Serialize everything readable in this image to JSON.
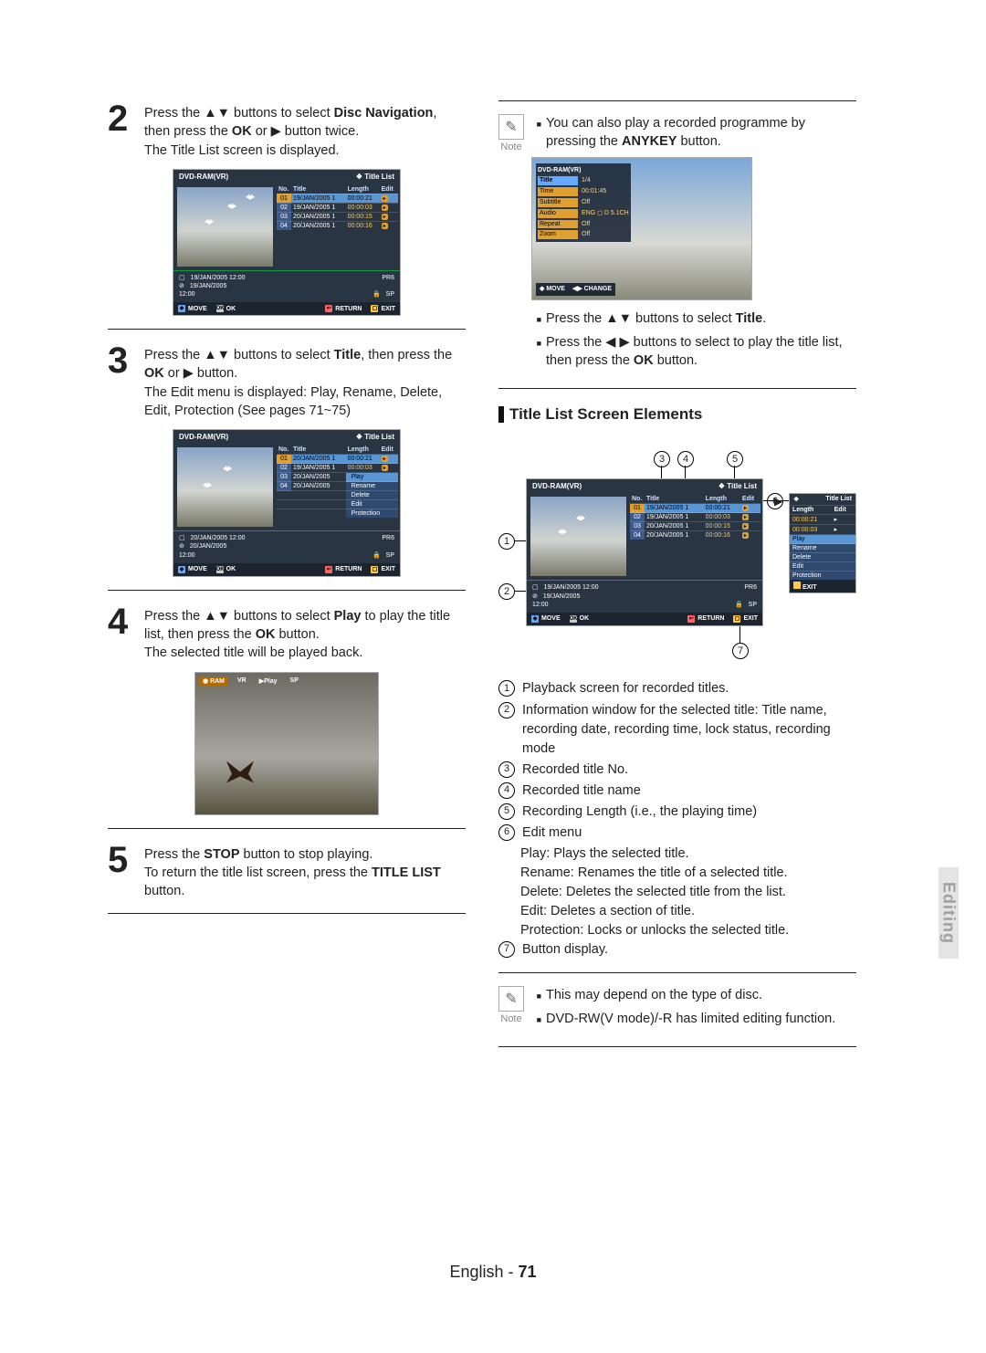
{
  "left": {
    "step2": {
      "num": "2",
      "pre": "Press the ",
      "arrows": "▲▼",
      "mid1": " buttons to select ",
      "bold1": "Disc Navigation",
      "mid2": ", then press the ",
      "bold2": "OK",
      "mid3": " or ",
      "play": "▶",
      "mid4": " button twice.",
      "line2": "The Title List screen is displayed."
    },
    "step3": {
      "num": "3",
      "pre": "Press the ",
      "arrows": "▲▼",
      "mid1": " buttons to select ",
      "bold1": "Title",
      "mid2": ", then press the ",
      "bold2": "OK",
      "mid3": " or ",
      "play": "▶",
      "mid4": " button.",
      "line2": "The Edit menu is displayed: Play, Rename, Delete, Edit, Protection (See pages 71~75)"
    },
    "step4": {
      "num": "4",
      "pre": "Press the ",
      "arrows": "▲▼",
      "mid1": " buttons to select ",
      "bold1": "Play",
      "mid2": " to play the title list, then press the ",
      "bold2": "OK",
      "mid3": " button.",
      "line2": "The selected title will be played back."
    },
    "step5": {
      "num": "5",
      "pre": "Press the ",
      "bold1": "STOP",
      "mid1": " button to stop playing.",
      "line2a": "To return the title list screen, press the ",
      "bold2": "TITLE LIST",
      "line2b": " button."
    },
    "osd1": {
      "device": "DVD-RAM(VR)",
      "title": "Title List",
      "cols": [
        "No.",
        "Title",
        "Length",
        "Edit"
      ],
      "rows": [
        {
          "no": "01",
          "title": "19/JAN/2005 1",
          "len": "00:00:21",
          "hl": true
        },
        {
          "no": "02",
          "title": "19/JAN/2005 1",
          "len": "00:00:03"
        },
        {
          "no": "03",
          "title": "20/JAN/2005 1",
          "len": "00:00:15"
        },
        {
          "no": "04",
          "title": "20/JAN/2005 1",
          "len": "00:00:16"
        }
      ],
      "info": {
        "a": "19/JAN/2005 12:00",
        "b": "PR6",
        "c": "19/JAN/2005",
        "d": "12:00",
        "e": "SP"
      },
      "bar": {
        "move": "MOVE",
        "ok": "OK",
        "ret": "RETURN",
        "exit": "EXIT"
      }
    },
    "osd2": {
      "device": "DVD-RAM(VR)",
      "title": "Title List",
      "cols": [
        "No.",
        "Title",
        "Length",
        "Edit"
      ],
      "rows": [
        {
          "no": "01",
          "title": "20/JAN/2005 1",
          "len": "00:00:21",
          "hl": true
        },
        {
          "no": "02",
          "title": "19/JAN/2005 1",
          "len": "00:00:03"
        },
        {
          "no": "03",
          "title": "20/JAN/2005",
          "sub": "Play"
        },
        {
          "no": "04",
          "title": "20/JAN/2005",
          "sub": "Rename"
        }
      ],
      "submenu": [
        "Delete",
        "Edit",
        "Protection"
      ],
      "info": {
        "a": "20/JAN/2005 12:00",
        "b": "PR6",
        "c": "20/JAN/2005",
        "d": "12:00",
        "e": "SP"
      },
      "bar": {
        "move": "MOVE",
        "ok": "OK",
        "ret": "RETURN",
        "exit": "EXIT"
      }
    },
    "play": {
      "ram": "RAM",
      "vr": "VR",
      "play": "▶Play",
      "sp": "SP"
    }
  },
  "right": {
    "note1": {
      "label": "Note",
      "li1a": "You can also play a recorded programme by pressing the ",
      "li1b": "ANYKEY",
      "li1c": " button.",
      "li2a": "Press the ",
      "li2arrows": "▲▼",
      "li2b": " buttons to select ",
      "li2c": "Title",
      "li2d": ".",
      "li3a": "Press the ",
      "li3arrows": "◀ ▶",
      "li3b": " buttons to select to play the title list, then press the ",
      "li3c": "OK",
      "li3d": " button."
    },
    "anykey": {
      "device": "DVD-RAM(VR)",
      "rows": [
        {
          "lab": "Title",
          "val": "1/4"
        },
        {
          "lab": "Time",
          "val": "00:01:45"
        },
        {
          "lab": "Subtitle",
          "val": "Off"
        },
        {
          "lab": "Audio",
          "val": "ENG ◻ D  5.1CH"
        },
        {
          "lab": "Repeat",
          "val": "Off"
        },
        {
          "lab": "Zoom",
          "val": "Off"
        }
      ],
      "bar": {
        "move": "MOVE",
        "change": "CHANGE"
      }
    },
    "section": "Title List Screen Elements",
    "diagram_osd": {
      "device": "DVD-RAM(VR)",
      "title": "Title List",
      "cols": [
        "No.",
        "Title",
        "Length",
        "Edit"
      ],
      "rows": [
        {
          "no": "01",
          "title": "19/JAN/2005 1",
          "len": "00:00:21",
          "hl": true
        },
        {
          "no": "02",
          "title": "19/JAN/2005 1",
          "len": "00:00:03"
        },
        {
          "no": "03",
          "title": "20/JAN/2005 1",
          "len": "00:00:15"
        },
        {
          "no": "04",
          "title": "20/JAN/2005 1",
          "len": "00:00:16"
        }
      ],
      "info": {
        "a": "19/JAN/2005 12:00",
        "b": "PR6",
        "c": "19/JAN/2005",
        "d": "12:00",
        "e": "SP"
      },
      "bar": {
        "move": "MOVE",
        "ok": "OK",
        "ret": "RETURN",
        "exit": "EXIT"
      }
    },
    "diagram_osd2": {
      "title": "Title List",
      "cols": [
        "Length",
        "Edit"
      ],
      "rows": [
        {
          "len": "00:00:21"
        },
        {
          "len": "00:00:03"
        }
      ],
      "menu": [
        "Play",
        "Rename",
        "Delete",
        "Edit",
        "Protection"
      ],
      "exit": "EXIT"
    },
    "callouts": {
      "c1": "1",
      "c2": "2",
      "c3": "3",
      "c4": "4",
      "c5": "5",
      "c6": "6",
      "c7": "7"
    },
    "legend": {
      "l1": "Playback screen for recorded titles.",
      "l2": "Information window for the selected title: Title name, recording date, recording time, lock status, recording mode",
      "l3": "Recorded title No.",
      "l4": "Recorded title name",
      "l5": "Recording Length (i.e., the playing time)",
      "l6": "Edit menu",
      "l6a": "Play: Plays the selected title.",
      "l6b": "Rename: Renames the title of a selected title.",
      "l6c": "Delete: Deletes the selected title from the list.",
      "l6d": "Edit: Deletes a section of title.",
      "l6e": "Protection: Locks or unlocks the selected title.",
      "l7": "Button display."
    },
    "note2": {
      "label": "Note",
      "li1": "This may depend on the type of disc.",
      "li2": "DVD-RW(V mode)/-R has limited editing function."
    }
  },
  "side_tab": "Editing",
  "footer": {
    "lang": "English - ",
    "page": "71"
  }
}
